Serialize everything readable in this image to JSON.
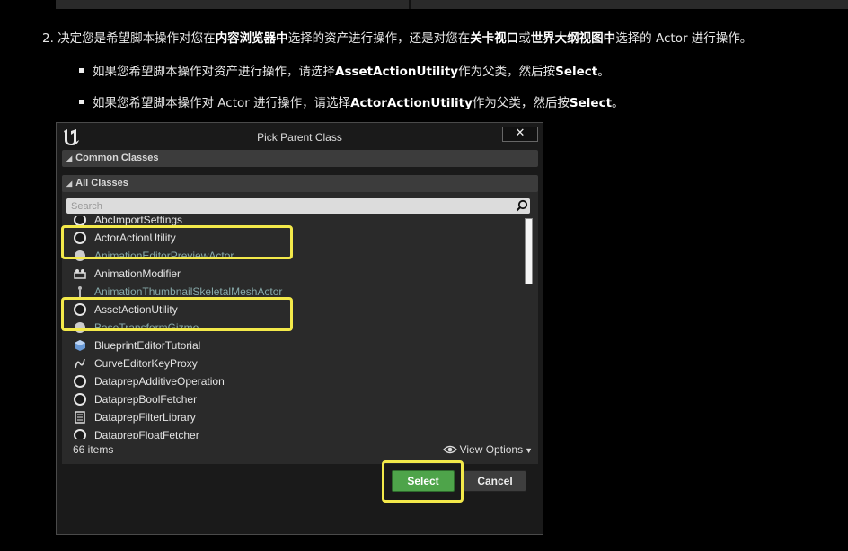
{
  "instructions": {
    "step_number": "2.",
    "step_text_a": "决定您是希望脚本操作对您在",
    "step_bold_a": "内容浏览器中",
    "step_text_b": "选择的资产进行操作，还是对您在",
    "step_bold_b": "关卡视口",
    "step_text_c": "或",
    "step_bold_c": "世界大纲视图中",
    "step_text_d": "选择的 Actor 进行操作。",
    "bullets": [
      {
        "text_a": "如果您希望脚本操作对资产进行操作，请选择",
        "bold_a": "AssetActionUtility",
        "text_b": "作为父类，然后按",
        "bold_b": "Select",
        "text_c": "。"
      },
      {
        "text_a": "如果您希望脚本操作对 Actor 进行操作，请选择",
        "bold_a": "ActorActionUtility",
        "text_b": "作为父类，然后按",
        "bold_b": "Select",
        "text_c": "。"
      }
    ]
  },
  "dialog": {
    "title": "Pick Parent Class",
    "close_label": "✕",
    "common_classes_label": "Common Classes",
    "all_classes_label": "All Classes",
    "search_placeholder": "Search",
    "classes": [
      {
        "label": "AbcImportSettings",
        "icon": "circle-icon"
      },
      {
        "label": "ActorActionUtility",
        "icon": "circle-icon"
      },
      {
        "label": "AnimationEditorPreviewActor",
        "icon": "sphere-icon"
      },
      {
        "label": "AnimationModifier",
        "icon": "modifier-icon"
      },
      {
        "label": "AnimationThumbnailSkeletalMeshActor",
        "icon": "skeletal-mesh-icon"
      },
      {
        "label": "AssetActionUtility",
        "icon": "circle-icon"
      },
      {
        "label": "BaseTransformGizmo",
        "icon": "sphere-icon"
      },
      {
        "label": "BlueprintEditorTutorial",
        "icon": "cube-icon"
      },
      {
        "label": "CurveEditorKeyProxy",
        "icon": "curve-icon"
      },
      {
        "label": "DataprepAdditiveOperation",
        "icon": "circle-icon"
      },
      {
        "label": "DataprepBoolFetcher",
        "icon": "circle-icon"
      },
      {
        "label": "DataprepFilterLibrary",
        "icon": "library-icon"
      },
      {
        "label": "DataprepFloatFetcher",
        "icon": "circle-icon"
      }
    ],
    "items_count": "66 items",
    "view_options_label": "View Options",
    "select_label": "Select",
    "cancel_label": "Cancel"
  },
  "colors": {
    "highlight": "#f3e94a",
    "select_button": "#4ea44a",
    "background": "#000000"
  }
}
